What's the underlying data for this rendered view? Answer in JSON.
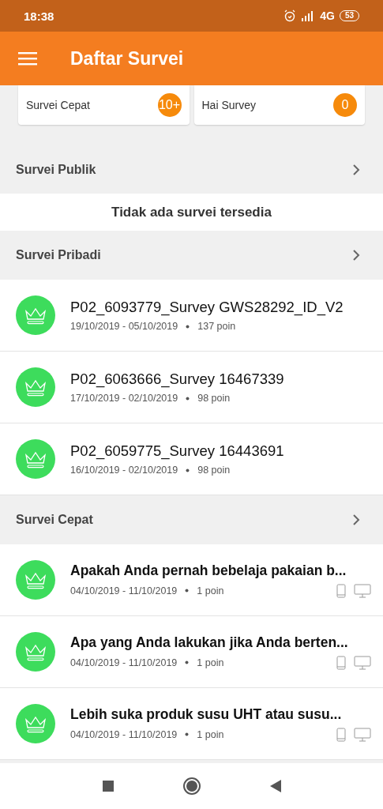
{
  "status_bar": {
    "time": "18:38",
    "network": "4G",
    "battery": "53"
  },
  "app_bar": {
    "title": "Daftar Survei"
  },
  "summary_cards": [
    {
      "label": "Survei Cepat",
      "count": "10+"
    },
    {
      "label": "Hai Survey",
      "count": "0"
    }
  ],
  "sections": [
    {
      "title": "Survei Publik",
      "empty_text": "Tidak ada survei tersedia"
    },
    {
      "title": "Survei Pribadi",
      "items": [
        {
          "kind": "private",
          "title": "P02_6093779_Survey GWS28292_ID_V2",
          "dates": "19/10/2019 - 05/10/2019",
          "points": "137 poin"
        },
        {
          "kind": "private",
          "title": "P02_6063666_Survey 16467339",
          "dates": "17/10/2019 - 02/10/2019",
          "points": "98 poin"
        },
        {
          "kind": "private",
          "title": "P02_6059775_Survey 16443691",
          "dates": "16/10/2019 - 02/10/2019",
          "points": "98 poin"
        }
      ]
    },
    {
      "title": "Survei Cepat",
      "items": [
        {
          "kind": "quick",
          "title": "Apakah Anda pernah bebelaja pakaian b...",
          "dates": "04/10/2019 - 11/10/2019",
          "points": "1 poin"
        },
        {
          "kind": "quick",
          "title": "Apa yang Anda lakukan jika Anda berten...",
          "dates": "04/10/2019 - 11/10/2019",
          "points": "1 poin"
        },
        {
          "kind": "quick",
          "title": "Lebih suka produk susu UHT atau susu...",
          "dates": "04/10/2019 - 11/10/2019",
          "points": "1 poin"
        }
      ]
    }
  ]
}
